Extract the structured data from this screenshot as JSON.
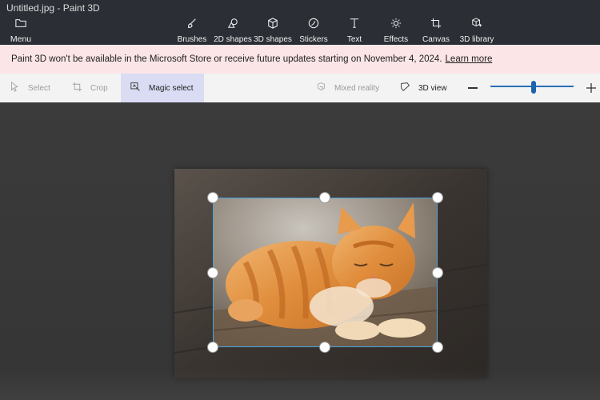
{
  "window": {
    "title": "Untitled.jpg - Paint 3D"
  },
  "menu": {
    "label": "Menu",
    "icon": "folder-icon"
  },
  "toolbar": {
    "tools": [
      {
        "id": "brushes",
        "label": "Brushes",
        "icon": "brush-icon"
      },
      {
        "id": "2d-shapes",
        "label": "2D shapes",
        "icon": "shapes-2d-icon"
      },
      {
        "id": "3d-shapes",
        "label": "3D shapes",
        "icon": "cube-icon"
      },
      {
        "id": "stickers",
        "label": "Stickers",
        "icon": "sticker-icon"
      },
      {
        "id": "text",
        "label": "Text",
        "icon": "text-icon"
      },
      {
        "id": "effects",
        "label": "Effects",
        "icon": "sun-icon"
      },
      {
        "id": "canvas",
        "label": "Canvas",
        "icon": "canvas-crop-icon"
      },
      {
        "id": "3d-library",
        "label": "3D library",
        "icon": "library-cube-icon"
      }
    ]
  },
  "banner": {
    "message": "Paint 3D won't be available in the Microsoft Store or receive future updates starting on November 4, 2024.",
    "link": "Learn more"
  },
  "subbar": {
    "select_label": "Select",
    "crop_label": "Crop",
    "magic_select_label": "Magic select",
    "mixed_reality_label": "Mixed reality",
    "view_3d_label": "3D view",
    "zoom_level": 0.52
  },
  "colors": {
    "titlebar_bg": "#2b2e35",
    "banner_bg": "#fbe5e6",
    "active_tool_bg": "#d9dcf2",
    "selection_border": "#4aa3df",
    "slider_accent": "#1d63ad"
  }
}
